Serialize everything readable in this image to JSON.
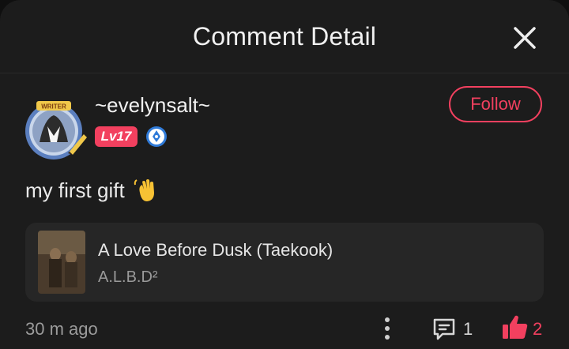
{
  "header": {
    "title": "Comment Detail",
    "close_icon": "close-icon"
  },
  "user": {
    "name": "~evelynsalt~",
    "level": "Lv17",
    "avatar_frame_label": "WRITER",
    "follow_label": "Follow"
  },
  "comment": {
    "text": "my first gift",
    "emoji": "waving-hand"
  },
  "book": {
    "title": "A Love Before Dusk (Taekook)",
    "author": "A.L.B.D²"
  },
  "footer": {
    "timestamp": "30 m ago",
    "reply_count": "1",
    "like_count": "2"
  },
  "colors": {
    "accent": "#f2405f",
    "background": "#1c1c1c",
    "card": "#262626",
    "muted_text": "#9b9b9b"
  }
}
